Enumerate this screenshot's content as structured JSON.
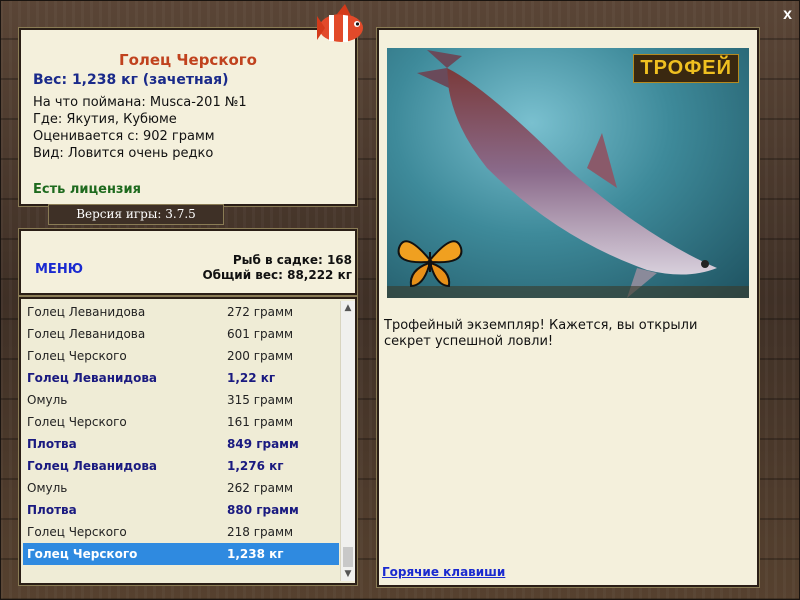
{
  "window": {
    "close_label": "x"
  },
  "info": {
    "fish_name": "Голец Черского",
    "weight": "Вес: 1,238 кг (зачетная)",
    "caught_with": "На что поймана: Musca-201 №1",
    "location": "Где: Якутия, Кубюме",
    "valued_from": "Оценивается с: 902 грамм",
    "type": "Вид: Ловится очень редко",
    "license": "Есть лицензия"
  },
  "version": {
    "label": "Версия игры: 3.7.5"
  },
  "menu": {
    "label": "МЕНЮ"
  },
  "stats": {
    "fish_count": "Рыб в садке: 168",
    "total_weight": "Общий вес: 88,222 кг"
  },
  "list": {
    "rows": [
      {
        "name": "Голец Леванидова",
        "weight": "272 грамм"
      },
      {
        "name": "Голец Леванидова",
        "weight": "601 грамм"
      },
      {
        "name": "Голец Черского",
        "weight": "200 грамм"
      },
      {
        "name": "Голец Леванидова",
        "weight": "1,22 кг"
      },
      {
        "name": "Омуль",
        "weight": "315 грамм"
      },
      {
        "name": "Голец Черского",
        "weight": "161 грамм"
      },
      {
        "name": "Плотва",
        "weight": "849 грамм"
      },
      {
        "name": "Голец Леванидова",
        "weight": "1,276 кг"
      },
      {
        "name": "Омуль",
        "weight": "262 грамм"
      },
      {
        "name": "Плотва",
        "weight": "880 грамм"
      },
      {
        "name": "Голец Черского",
        "weight": "218 грамм"
      },
      {
        "name": "Голец Черского",
        "weight": "1,238 кг"
      }
    ]
  },
  "right": {
    "trophy_badge": "ТРОФЕЙ",
    "message": "Трофейный экземпляр! Кажется, вы открыли секрет успешной ловли!",
    "hotkeys": "Горячие клавиши"
  }
}
